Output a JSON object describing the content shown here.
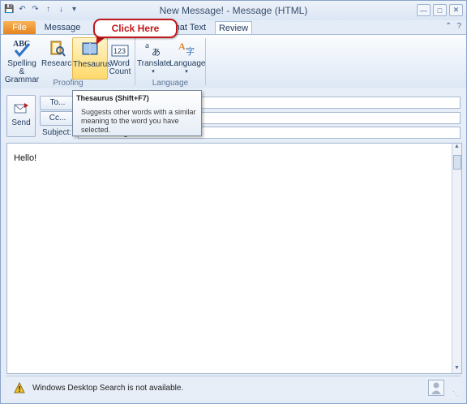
{
  "window": {
    "title": "New Message! - Message (HTML)"
  },
  "qat": {
    "icons": [
      "save-icon",
      "undo-icon",
      "redo-icon",
      "up-arrow-icon",
      "down-arrow-icon",
      "customize-icon"
    ]
  },
  "tabs": {
    "file": "File",
    "message": "Message",
    "format_text": "rmat Text",
    "review": "Review"
  },
  "ribbon": {
    "spelling": "Spelling &",
    "spelling2": "Grammar",
    "research": "Research",
    "thesaurus": "Thesaurus",
    "word": "Word",
    "count": "Count",
    "translate": "Translate",
    "language": "Language",
    "group_proofing": "Proofing",
    "group_language": "Language",
    "abc_glyph": "ABC",
    "count_glyph": "123"
  },
  "callout": {
    "text": "Click Here"
  },
  "tooltip": {
    "title": "Thesaurus (Shift+F7)",
    "description": "Suggests other words with a similar meaning to the word you have selected."
  },
  "header": {
    "send": "Send",
    "to": "To...",
    "cc": "Cc...",
    "subject_label": "Subject:",
    "subject_value": "New Message!"
  },
  "message_body": "Hello!",
  "status": {
    "text": "Windows Desktop Search is not available."
  },
  "colors": {
    "file_tab": "#e5831f",
    "callout_border": "#c0171b",
    "highlight": "#ffd96b"
  }
}
